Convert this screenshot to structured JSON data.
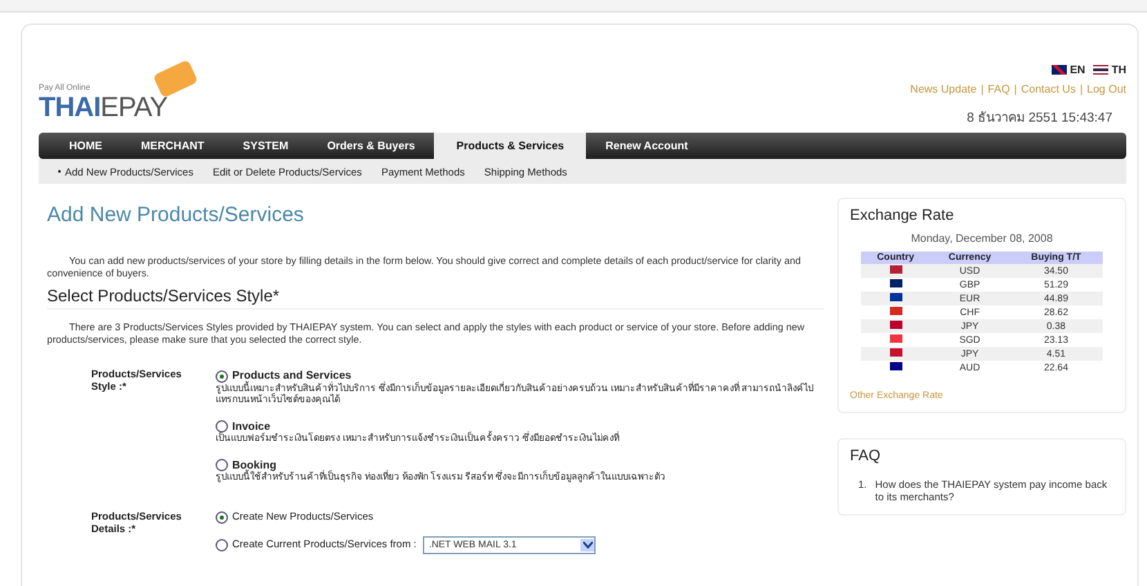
{
  "languages": [
    {
      "label": "EN",
      "kind": "uk"
    },
    {
      "label": "TH",
      "kind": "th"
    }
  ],
  "logo": {
    "tagline": "Pay All Online",
    "brand_a": "THAI",
    "brand_b": "EPAY"
  },
  "top_links": [
    "News Update",
    "FAQ",
    "Contact Us",
    "Log Out"
  ],
  "link_separator": "|",
  "datetime": "8 ธันวาคม 2551 15:43:47",
  "nav": [
    {
      "label": "HOME",
      "selected": false
    },
    {
      "label": "MERCHANT",
      "selected": false
    },
    {
      "label": "SYSTEM",
      "selected": false
    },
    {
      "label": "Orders & Buyers",
      "selected": false
    },
    {
      "label": "Products & Services",
      "selected": true
    },
    {
      "label": "Renew Account",
      "selected": false
    }
  ],
  "subnav": [
    {
      "label": "Add New Products/Services",
      "selected": true
    },
    {
      "label": "Edit or Delete Products/Services",
      "selected": false
    },
    {
      "label": "Payment Methods",
      "selected": false
    },
    {
      "label": "Shipping Methods",
      "selected": false
    }
  ],
  "page_title": "Add New Products/Services",
  "intro": "You can add new products/services of your store by filling details in the form below. You should give correct and complete details of each product/service for clarity and convenience of buyers.",
  "section_title": "Select Products/Services Style*",
  "section_intro": "There are 3 Products/Services Styles provided by THAIEPAY system. You can select and apply the styles with each product or service of your store. Before adding new products/services, please make sure that you selected the correct style.",
  "style_field": {
    "label": "Products/Services Style :*",
    "options": [
      {
        "label": "Products and Services",
        "selected": true,
        "description": "รูปแบบนี้เหมาะสำหรับสินค้าทั่วไปบริการ ซึ่งมีการเก็บข้อมูลรายละเอียดเกี่ยวกับสินค้าอย่างครบถ้วน เหมาะสำหรับสินค้าที่มีราคาคงที่ สามารถนำลิงค์ไปแทรกบนหน้าเว็บไซต์ของคุณได้"
      },
      {
        "label": "Invoice",
        "selected": false,
        "description": "เป็นแบบฟอร์มชำระเงินโดยตรง เหมาะสำหรับการแจ้งชำระเงินเป็นครั้งคราว ซึ่งมียอดชำระเงินไม่คงที่"
      },
      {
        "label": "Booking",
        "selected": false,
        "description": "รูปแบบนี้ใช้สำหรับร้านค้าที่เป็นธุรกิจ ท่องเที่ยว ห้องพัก โรงแรม รีสอร์ท ซึ่งจะมีการเก็บข้อมูลลูกค้าในแบบเฉพาะตัว"
      }
    ]
  },
  "details_field": {
    "label": "Products/Services Details :*",
    "options": [
      {
        "label": "Create New Products/Services",
        "selected": true
      },
      {
        "label": "Create Current Products/Services from :",
        "selected": false,
        "dropdown": ".NET WEB MAIL 3.1"
      }
    ]
  },
  "exchange": {
    "title": "Exchange Rate",
    "date": "Monday, December 08, 2008",
    "columns": [
      "Country",
      "Currency",
      "Buying T/T"
    ],
    "rows": [
      {
        "color": "#b22234",
        "currency": "USD",
        "rate": "34.50"
      },
      {
        "color": "#012169",
        "currency": "GBP",
        "rate": "51.29"
      },
      {
        "color": "#003399",
        "currency": "EUR",
        "rate": "44.89"
      },
      {
        "color": "#d52b1e",
        "currency": "CHF",
        "rate": "28.62"
      },
      {
        "color": "#bc002d",
        "currency": "JPY",
        "rate": "0.38"
      },
      {
        "color": "#ef3340",
        "currency": "SGD",
        "rate": "23.13"
      },
      {
        "color": "#c8102e",
        "currency": "JPY",
        "rate": "4.51"
      },
      {
        "color": "#00008b",
        "currency": "AUD",
        "rate": "22.64"
      }
    ],
    "link": "Other Exchange Rate"
  },
  "faq": {
    "title": "FAQ",
    "items": [
      {
        "number": "1.",
        "question": "How does the THAIEPAY system pay income back to its merchants?"
      }
    ]
  }
}
